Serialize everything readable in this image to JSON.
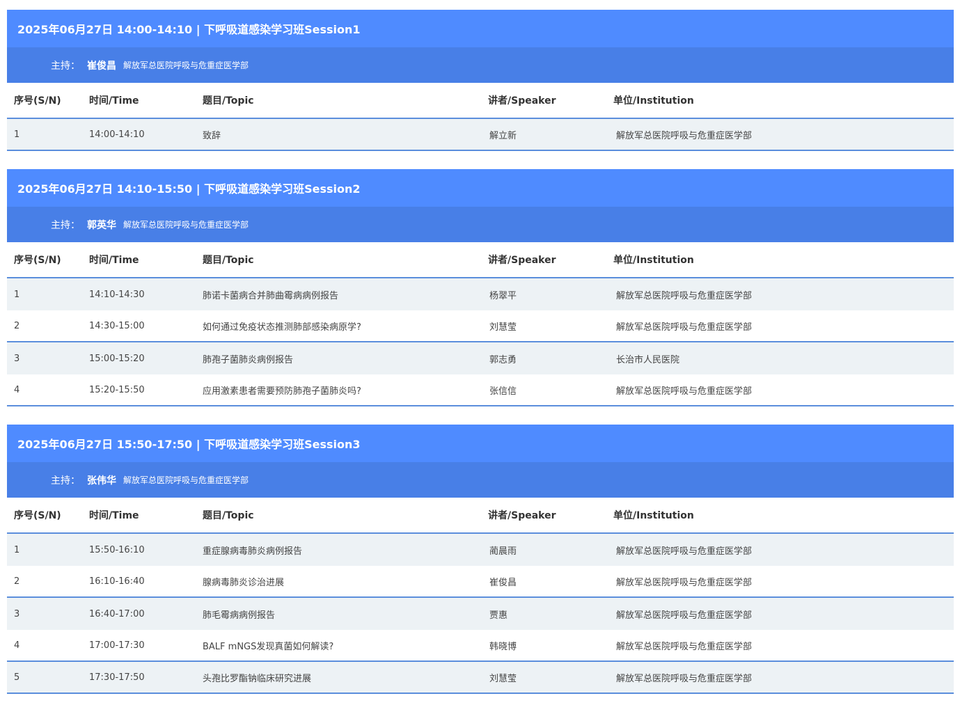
{
  "columns": {
    "sn": "序号(S/N)",
    "time": "时间/Time",
    "topic": "题目/Topic",
    "speaker": "讲者/Speaker",
    "institution": "单位/Institution"
  },
  "host_label": "主持：",
  "sessions": [
    {
      "title": "2025年06月27日 14:00-14:10 | 下呼吸道感染学习班Session1",
      "host_name": "崔俊昌",
      "host_inst": "解放军总医院呼吸与危重症医学部",
      "rows": [
        {
          "sn": "1",
          "time": "14:00-14:10",
          "topic": "致辞",
          "speaker": "解立新",
          "institution": "解放军总医院呼吸与危重症医学部"
        }
      ]
    },
    {
      "title": "2025年06月27日 14:10-15:50 | 下呼吸道感染学习班Session2",
      "host_name": "郭英华",
      "host_inst": "解放军总医院呼吸与危重症医学部",
      "rows": [
        {
          "sn": "1",
          "time": "14:10-14:30",
          "topic": "肺诺卡菌病合并肺曲霉病病例报告",
          "speaker": "杨翠平",
          "institution": "解放军总医院呼吸与危重症医学部"
        },
        {
          "sn": "2",
          "time": "14:30-15:00",
          "topic": "如何通过免疫状态推测肺部感染病原学?",
          "speaker": "刘慧莹",
          "institution": "解放军总医院呼吸与危重症医学部"
        },
        {
          "sn": "3",
          "time": "15:00-15:20",
          "topic": "肺孢子菌肺炎病例报告",
          "speaker": "郭志勇",
          "institution": "长治市人民医院"
        },
        {
          "sn": "4",
          "time": "15:20-15:50",
          "topic": "应用激素患者需要预防肺孢子菌肺炎吗?",
          "speaker": "张信信",
          "institution": "解放军总医院呼吸与危重症医学部"
        }
      ]
    },
    {
      "title": "2025年06月27日 15:50-17:50 | 下呼吸道感染学习班Session3",
      "host_name": "张伟华",
      "host_inst": "解放军总医院呼吸与危重症医学部",
      "rows": [
        {
          "sn": "1",
          "time": "15:50-16:10",
          "topic": "重症腺病毒肺炎病例报告",
          "speaker": "蔺晨雨",
          "institution": "解放军总医院呼吸与危重症医学部"
        },
        {
          "sn": "2",
          "time": "16:10-16:40",
          "topic": "腺病毒肺炎诊治进展",
          "speaker": "崔俊昌",
          "institution": "解放军总医院呼吸与危重症医学部"
        },
        {
          "sn": "3",
          "time": "16:40-17:00",
          "topic": "肺毛霉病病例报告",
          "speaker": "贾惠",
          "institution": "解放军总医院呼吸与危重症医学部"
        },
        {
          "sn": "4",
          "time": "17:00-17:30",
          "topic": "BALF mNGS发现真菌如何解读?",
          "speaker": "韩晓博",
          "institution": "解放军总医院呼吸与危重症医学部"
        },
        {
          "sn": "5",
          "time": "17:30-17:50",
          "topic": "头孢比罗酯钠临床研究进展",
          "speaker": "刘慧莹",
          "institution": "解放军总医院呼吸与危重症医学部"
        }
      ]
    }
  ]
}
